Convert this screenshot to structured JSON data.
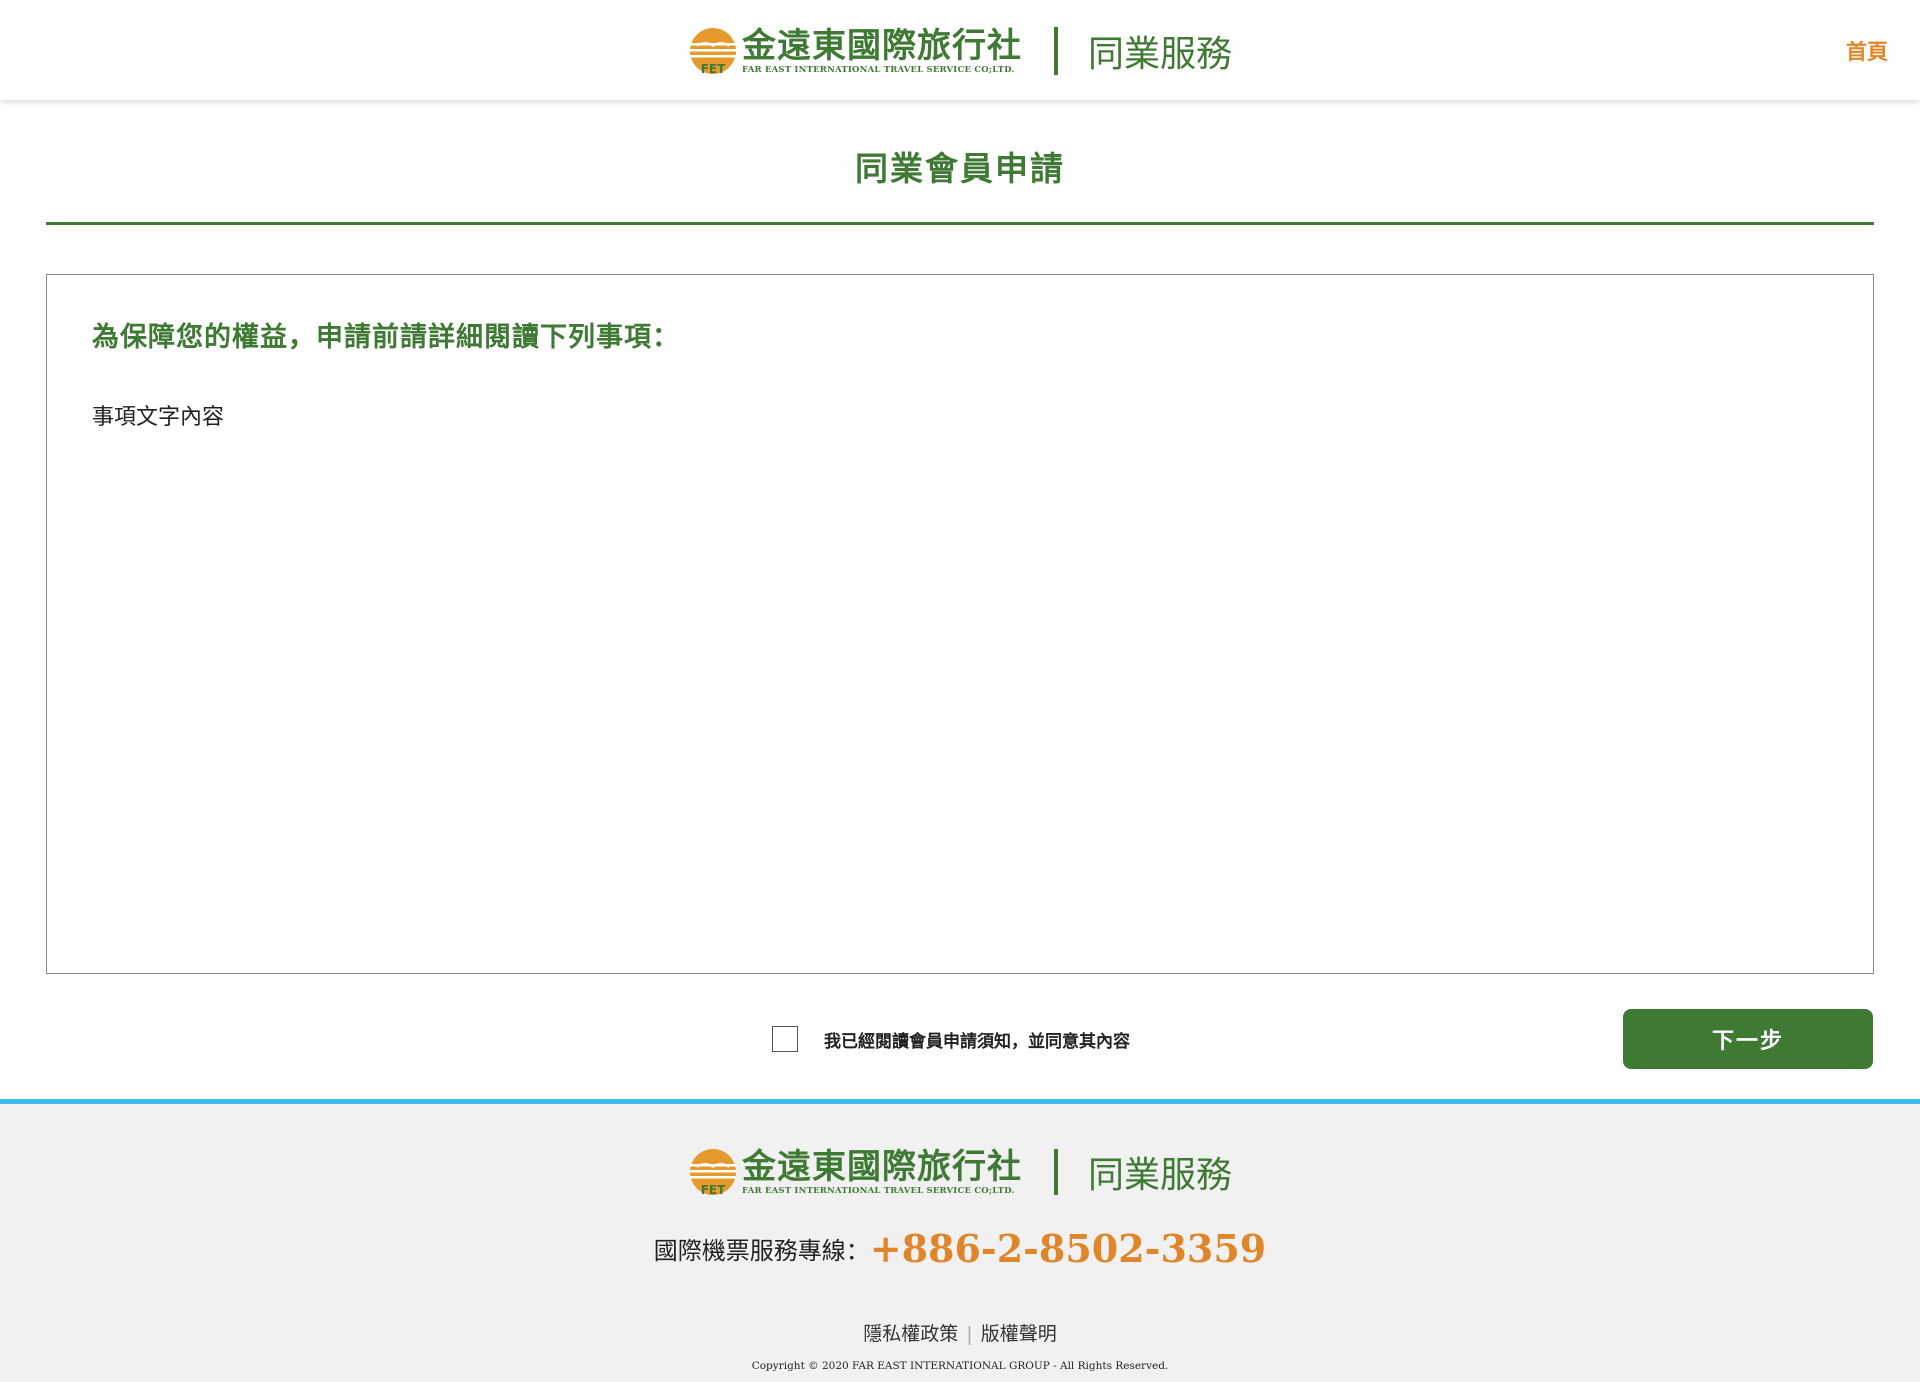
{
  "header": {
    "logo": {
      "name": "金遠東國際旅行社",
      "en": "FAR EAST INTERNATIONAL TRAVEL SERVICE CO;LTD.",
      "badge": "FET"
    },
    "service": "同業服務",
    "home_link": "首頁"
  },
  "page": {
    "title": "同業會員申請"
  },
  "notice": {
    "heading": "為保障您的權益，申請前請詳細閱讀下列事項：",
    "body": "事項文字內容"
  },
  "agreement": {
    "label": "我已經閱讀會員申請須知，並同意其內容",
    "checked": false
  },
  "next_button": "下一步",
  "footer": {
    "logo": {
      "name": "金遠東國際旅行社",
      "en": "FAR EAST INTERNATIONAL TRAVEL SERVICE CO;LTD.",
      "badge": "FET"
    },
    "service": "同業服務",
    "hotline_label": "國際機票服務專線：",
    "hotline_number": "+886-2-8502-3359",
    "links": [
      "隱私權政策",
      "版權聲明"
    ],
    "copyright": "Copyright © 2020 FAR EAST INTERNATIONAL GROUP - All Rights Reserved."
  },
  "colors": {
    "brand_green": "#3f7a34",
    "accent_orange": "#e0862a",
    "footer_top_border": "#3fbcee",
    "footer_bg": "#f1f1f1"
  }
}
